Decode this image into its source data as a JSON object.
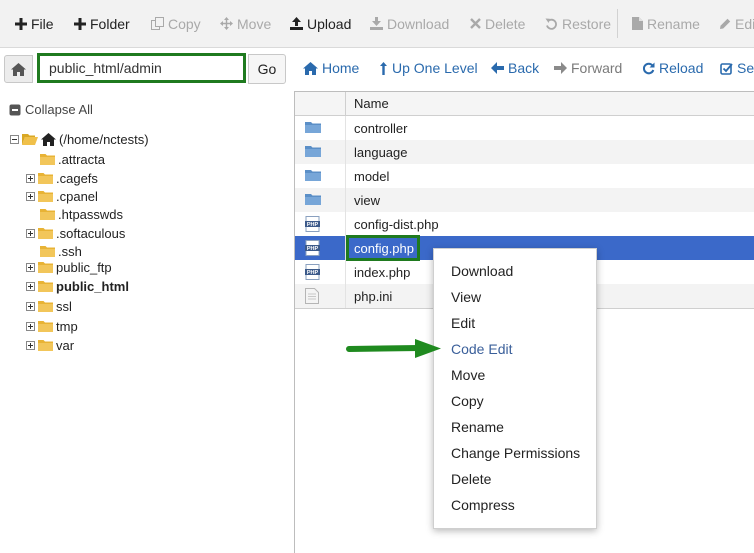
{
  "toolbar": {
    "file": "File",
    "folder": "Folder",
    "copy": "Copy",
    "move": "Move",
    "upload": "Upload",
    "download": "Download",
    "delete": "Delete",
    "restore": "Restore",
    "rename": "Rename",
    "edit": "Edit"
  },
  "path": {
    "value": "public_html/admin",
    "go": "Go"
  },
  "nav": {
    "home": "Home",
    "up": "Up One Level",
    "back": "Back",
    "forward": "Forward",
    "reload": "Reload",
    "select": "Sele"
  },
  "tree": {
    "collapse_all": "Collapse All",
    "root": "(/home/nctests)",
    "items": [
      {
        "label": ".attracta"
      },
      {
        "label": ".cagefs"
      },
      {
        "label": ".cpanel"
      },
      {
        "label": ".htpasswds"
      },
      {
        "label": ".softaculous"
      },
      {
        "label": ".ssh"
      },
      {
        "label": "public_ftp"
      },
      {
        "label": "public_html"
      },
      {
        "label": "ssl"
      },
      {
        "label": "tmp"
      },
      {
        "label": "var"
      }
    ]
  },
  "files": {
    "column_name": "Name",
    "rows": [
      {
        "name": "controller",
        "icon": "folder-icon"
      },
      {
        "name": "language",
        "icon": "folder-icon"
      },
      {
        "name": "model",
        "icon": "folder-icon"
      },
      {
        "name": "view",
        "icon": "folder-icon"
      },
      {
        "name": "config-dist.php",
        "icon": "php-file-icon"
      },
      {
        "name": "config.php",
        "icon": "php-file-icon"
      },
      {
        "name": "index.php",
        "icon": "php-file-icon"
      },
      {
        "name": "php.ini",
        "icon": "text-file-icon"
      }
    ],
    "selected": "config.php"
  },
  "context_menu": {
    "items": [
      {
        "label": "Download"
      },
      {
        "label": "View"
      },
      {
        "label": "Edit"
      },
      {
        "label": "Code Edit"
      },
      {
        "label": "Move"
      },
      {
        "label": "Copy"
      },
      {
        "label": "Rename"
      },
      {
        "label": "Change Permissions"
      },
      {
        "label": "Delete"
      },
      {
        "label": "Compress"
      }
    ],
    "highlighted": "Code Edit"
  },
  "colors": {
    "accent_green": "#1f7a1f",
    "selection_blue": "#3b69c9",
    "link_blue": "#2a6aad"
  }
}
